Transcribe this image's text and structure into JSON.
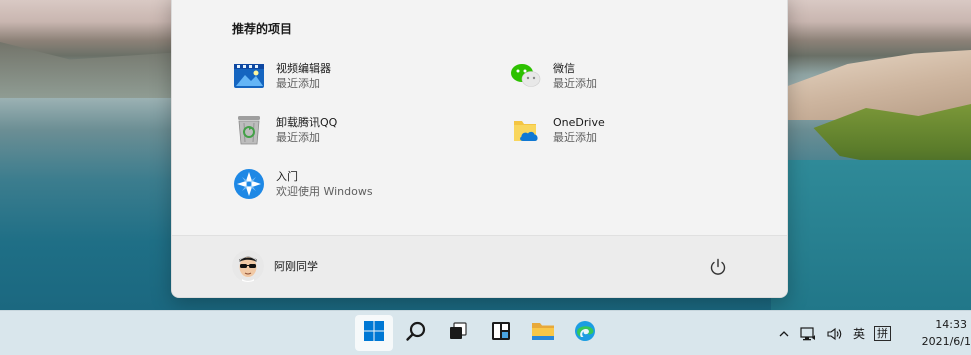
{
  "start_menu": {
    "recommended_title": "推荐的项目",
    "recommended": [
      {
        "name": "视频编辑器",
        "subtitle": "最近添加",
        "icon": "video-editor-icon"
      },
      {
        "name": "微信",
        "subtitle": "最近添加",
        "icon": "wechat-icon"
      },
      {
        "name": "卸载腾讯QQ",
        "subtitle": "最近添加",
        "icon": "recycle-bin-icon"
      },
      {
        "name": "OneDrive",
        "subtitle": "最近添加",
        "icon": "onedrive-icon"
      },
      {
        "name": "入门",
        "subtitle": "欢迎使用 Windows",
        "icon": "get-started-icon"
      }
    ],
    "user": {
      "name": "阿刚同学"
    },
    "power_icon": "power-icon"
  },
  "taskbar": {
    "apps": [
      {
        "name": "start",
        "icon": "windows-start-icon",
        "active": true
      },
      {
        "name": "search",
        "icon": "search-icon"
      },
      {
        "name": "task-view",
        "icon": "task-view-icon"
      },
      {
        "name": "widgets",
        "icon": "widgets-icon"
      },
      {
        "name": "file-explorer",
        "icon": "file-explorer-icon"
      },
      {
        "name": "edge",
        "icon": "edge-icon"
      }
    ],
    "tray": {
      "chevron": "^",
      "ime_lang": "英",
      "ime_mode": "拼"
    },
    "clock": {
      "time": "14:33",
      "date": "2021/6/1"
    }
  },
  "colors": {
    "accent": "#0067c0",
    "menu_bg": "#f3f3f3",
    "taskbar_bg": "#d9e6ec"
  }
}
